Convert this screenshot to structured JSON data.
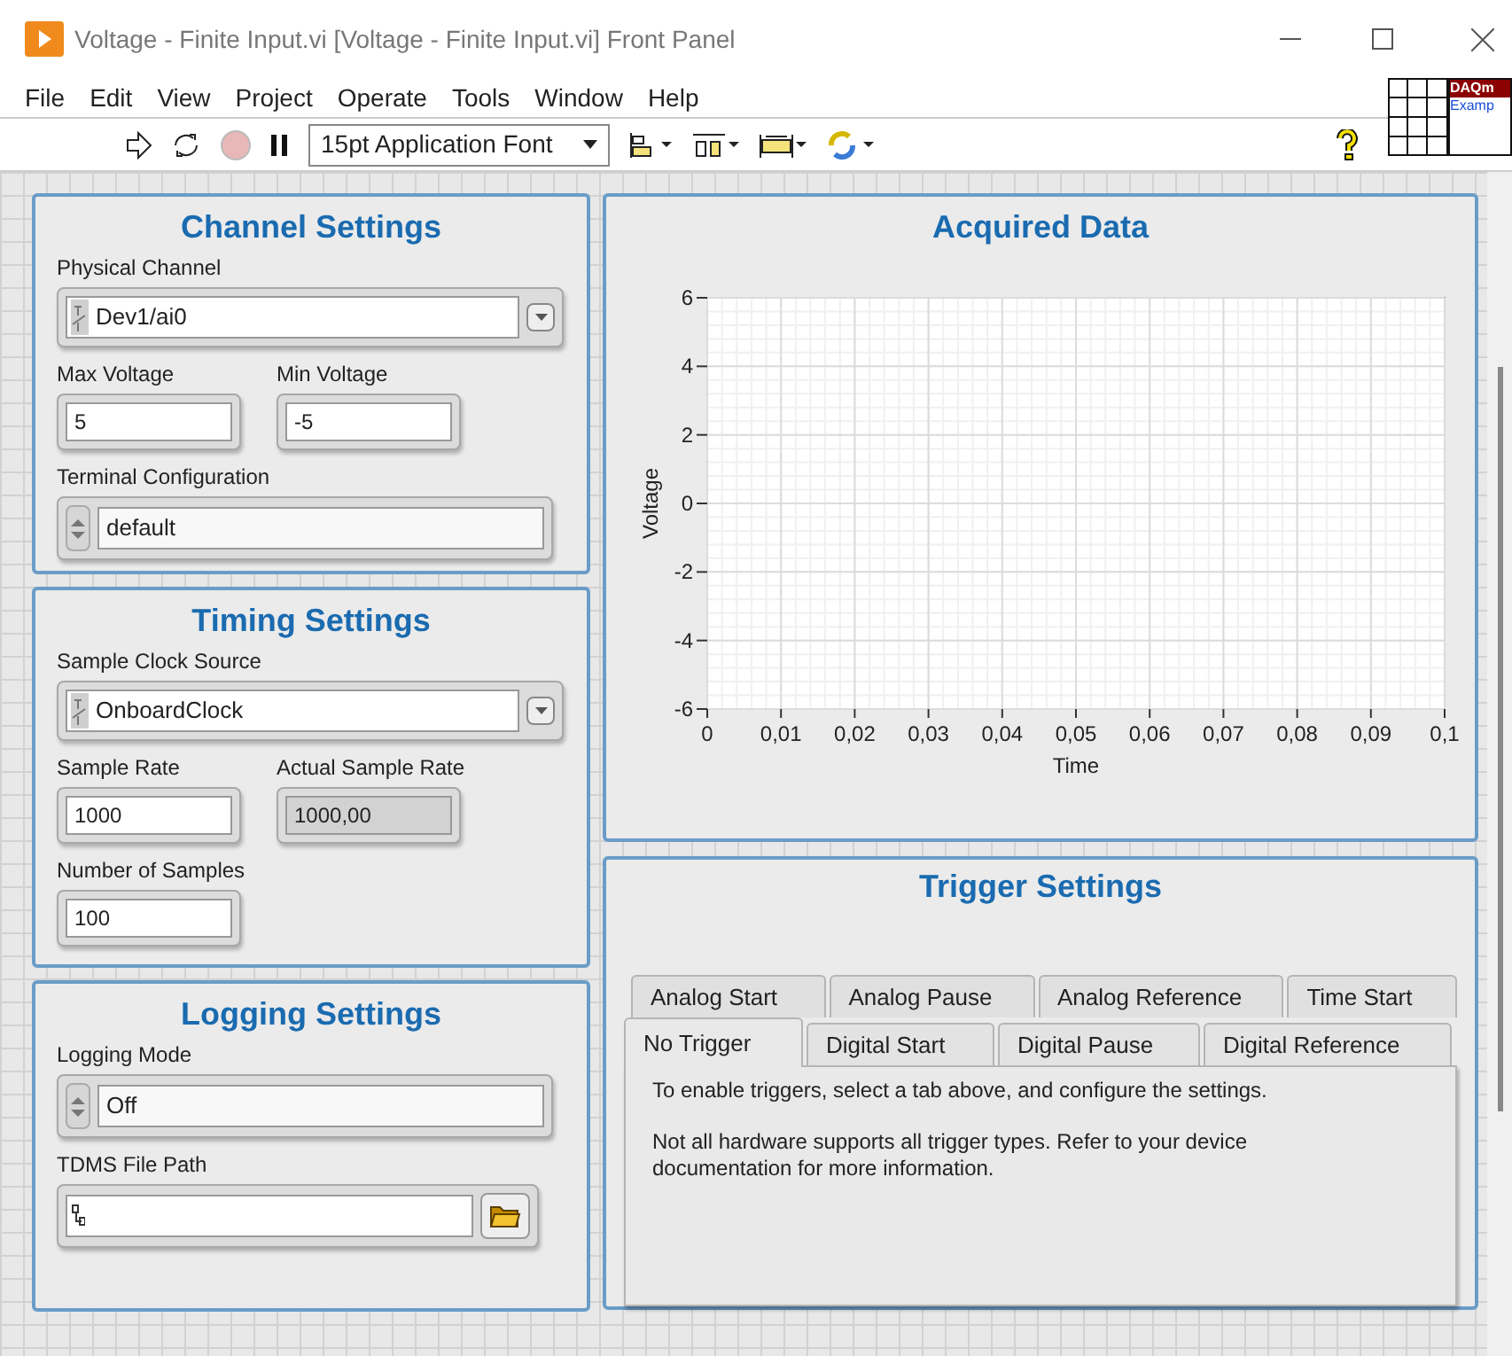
{
  "window": {
    "title": "Voltage - Finite Input.vi [Voltage - Finite Input.vi] Front Panel"
  },
  "menu": [
    "File",
    "Edit",
    "View",
    "Project",
    "Operate",
    "Tools",
    "Window",
    "Help"
  ],
  "toolbar": {
    "font": "15pt Application Font"
  },
  "vi_icon": {
    "line_1": "DAQm",
    "line_2": "Examp"
  },
  "left_panels": [
    {
      "title": "Channel Settings",
      "rows": [
        [
          {
            "kind": "ring",
            "label": "Physical Channel",
            "value": "Dev1/ai0"
          }
        ],
        [
          {
            "kind": "numeric",
            "label": "Max Voltage",
            "value": "5"
          },
          {
            "kind": "numeric",
            "label": "Min Voltage",
            "value": "-5"
          }
        ],
        [
          {
            "kind": "enum",
            "label": "Terminal Configuration",
            "value": "default"
          }
        ]
      ]
    },
    {
      "title": "Timing Settings",
      "rows": [
        [
          {
            "kind": "ring",
            "label": "Sample Clock Source",
            "value": "OnboardClock"
          }
        ],
        [
          {
            "kind": "numeric",
            "label": "Sample Rate",
            "value": "1000"
          },
          {
            "kind": "indicator",
            "label": "Actual Sample Rate",
            "value": "1000,00"
          }
        ],
        [
          {
            "kind": "numeric",
            "label": "Number of Samples",
            "value": "100"
          }
        ]
      ]
    },
    {
      "title": "Logging Settings",
      "rows": [
        [
          {
            "kind": "enum",
            "label": "Logging Mode",
            "value": "Off"
          }
        ],
        [
          {
            "kind": "path",
            "label": "TDMS File Path"
          }
        ]
      ]
    }
  ],
  "graph": {
    "title": "Acquired Data",
    "chart_data": {
      "type": "line",
      "grid": true,
      "xlabel": "Time",
      "ylabel": "Voltage",
      "xlim": [
        0,
        0.1
      ],
      "ylim": [
        -6,
        6
      ],
      "xticks": [
        0,
        {
          "value": 0.01,
          "label": "0,01"
        },
        {
          "value": 0.02,
          "label": "0,02"
        },
        {
          "value": 0.03,
          "label": "0,03"
        },
        {
          "value": 0.04,
          "label": "0,04"
        },
        {
          "value": 0.05,
          "label": "0,05"
        },
        {
          "value": 0.06,
          "label": "0,06"
        },
        {
          "value": 0.07,
          "label": "0,07"
        },
        {
          "value": 0.08,
          "label": "0,08"
        },
        {
          "value": 0.09,
          "label": "0,09"
        },
        {
          "value": 0.1,
          "label": "0,1"
        }
      ],
      "yticks": [
        6,
        4,
        2,
        0,
        -2,
        -4,
        -6
      ]
    }
  },
  "trigger": {
    "title": "Trigger Settings",
    "back_tabs": [
      {
        "label": "Analog Start",
        "selected": false
      },
      {
        "label": "Analog Pause",
        "selected": false
      },
      {
        "label": "Analog Reference",
        "selected": false
      },
      {
        "label": "Time Start",
        "selected": false
      }
    ],
    "front_tabs": [
      {
        "label": "No Trigger",
        "selected": true
      },
      {
        "label": "Digital Start",
        "selected": false
      },
      {
        "label": "Digital Pause",
        "selected": false
      },
      {
        "label": "Digital Reference",
        "selected": false
      }
    ],
    "paragraphs": [
      "To enable triggers, select a tab above, and configure the settings.",
      "Not all hardware supports all trigger types. Refer to your device documentation for more information."
    ]
  }
}
